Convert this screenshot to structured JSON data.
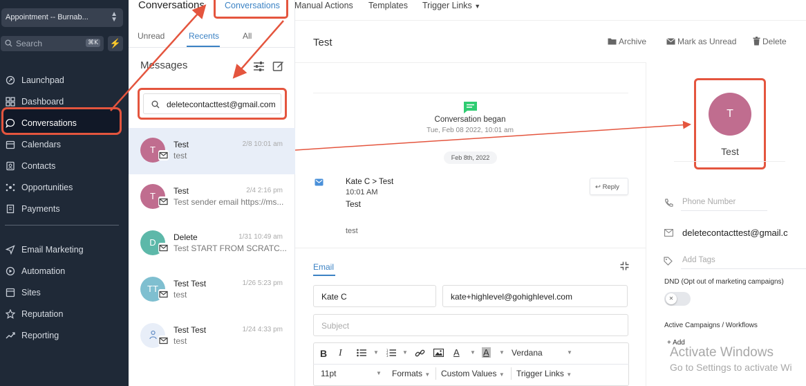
{
  "sidebar": {
    "location": "Appointment -- Burnab...",
    "search_placeholder": "Search",
    "search_shortcut": "⌘K",
    "items": [
      {
        "label": "Launchpad",
        "icon": "rocket-icon"
      },
      {
        "label": "Dashboard",
        "icon": "dashboard-icon"
      },
      {
        "label": "Conversations",
        "icon": "chat-icon",
        "active": true
      },
      {
        "label": "Calendars",
        "icon": "calendar-icon"
      },
      {
        "label": "Contacts",
        "icon": "contacts-icon"
      },
      {
        "label": "Opportunities",
        "icon": "funnel-icon"
      },
      {
        "label": "Payments",
        "icon": "receipt-icon"
      }
    ],
    "items2": [
      {
        "label": "Email Marketing",
        "icon": "send-icon"
      },
      {
        "label": "Automation",
        "icon": "automation-icon"
      },
      {
        "label": "Sites",
        "icon": "sites-icon"
      },
      {
        "label": "Reputation",
        "icon": "star-icon"
      },
      {
        "label": "Reporting",
        "icon": "chart-icon"
      }
    ]
  },
  "topnav": {
    "title": "Conversations",
    "tabs": [
      "Conversations",
      "Manual Actions",
      "Templates",
      "Trigger Links"
    ]
  },
  "list": {
    "tabs": [
      "Unread",
      "Recents",
      "All"
    ],
    "active_tab": "Recents",
    "heading": "Messages",
    "search_value": "deletecontacttest@gmail.com",
    "conversations": [
      {
        "initials": "T",
        "name": "Test",
        "date": "2/8 10:01 am",
        "preview": "test",
        "color": "#c06d8f",
        "selected": true
      },
      {
        "initials": "T",
        "name": "Test",
        "date": "2/4 2:16 pm",
        "preview": "Test sender email https://ms...",
        "color": "#c06d8f"
      },
      {
        "initials": "D",
        "name": "Delete",
        "date": "1/31 10:49 am",
        "preview": "Test START FROM SCRATC...",
        "color": "#5db8a9"
      },
      {
        "initials": "TT",
        "name": "Test Test",
        "date": "1/26 5:23 pm",
        "preview": "test",
        "color": "#7fbfd0"
      },
      {
        "initials": "",
        "name": "Test Test",
        "date": "1/24 4:33 pm",
        "preview": "test",
        "color": "#e8eef8"
      }
    ]
  },
  "thread": {
    "title": "Test",
    "actions": [
      "Archive",
      "Mark as Unread",
      "Delete"
    ],
    "began_label": "Conversation began",
    "began_date": "Tue, Feb 08 2022, 10:01 am",
    "date_pill": "Feb 8th, 2022",
    "message": {
      "from": "Kate C > Test",
      "time": "10:01 AM",
      "subject": "Test",
      "body": "test",
      "reply_label": "Reply"
    }
  },
  "composer": {
    "tab": "Email",
    "from_name": "Kate C",
    "from_email": "kate+highlevel@gohighlevel.com",
    "subject_placeholder": "Subject",
    "font": "Verdana",
    "size": "11pt",
    "formats": "Formats",
    "custom_values": "Custom Values",
    "trigger_links": "Trigger Links"
  },
  "contact": {
    "initial": "T",
    "name": "Test",
    "avatar_color": "#c06d8f",
    "phone_placeholder": "Phone Number",
    "email": "deletecontacttest@gmail.c",
    "tags_placeholder": "Add Tags",
    "dnd_label": "DND (Opt out of marketing campaigns)",
    "campaigns_label": "Active Campaigns / Workflows",
    "add_label": "+ Add"
  },
  "watermark": {
    "line1": "Activate Windows",
    "line2": "Go to Settings to activate Wi"
  },
  "colors": {
    "accent": "#3b82c4",
    "highlight": "#e4553e",
    "sidebar": "#1f2937"
  }
}
